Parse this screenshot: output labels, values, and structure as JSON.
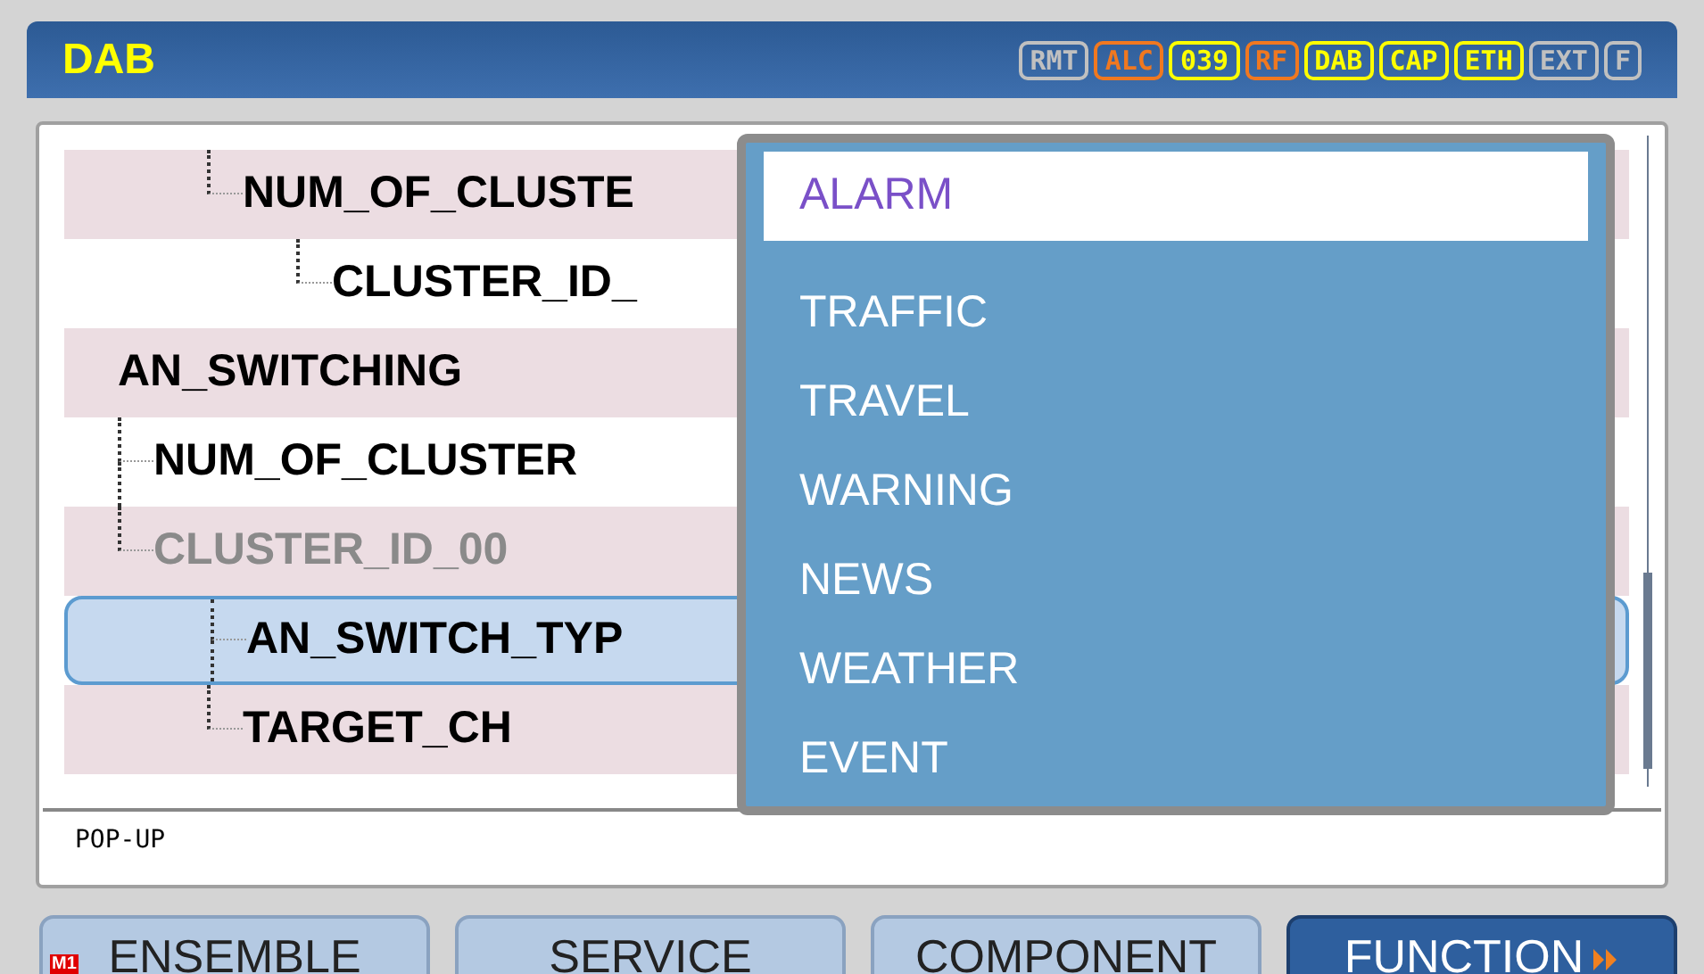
{
  "header": {
    "title": "DAB",
    "badges": [
      {
        "label": "RMT",
        "color": "#c0c0c0"
      },
      {
        "label": "ALC",
        "color": "#f07820"
      },
      {
        "label": "039",
        "color": "#ffff00"
      },
      {
        "label": "RF",
        "color": "#f07820"
      },
      {
        "label": "DAB",
        "color": "#ffff00"
      },
      {
        "label": "CAP",
        "color": "#ffff00"
      },
      {
        "label": "ETH",
        "color": "#ffff00"
      },
      {
        "label": "EXT",
        "color": "#c0c0c0"
      },
      {
        "label": "F",
        "color": "#c0c0c0"
      }
    ]
  },
  "tree": {
    "partial_branch": [
      {
        "label": "NUM_OF_CLUSTE",
        "disabled": false,
        "selected": false,
        "children": [
          {
            "label": "CLUSTER_ID_",
            "disabled": false,
            "selected": false
          }
        ]
      }
    ],
    "items": [
      {
        "label": "AN_SWITCHING",
        "disabled": false,
        "selected": false,
        "children": [
          {
            "label": "NUM_OF_CLUSTER",
            "disabled": false,
            "selected": false
          },
          {
            "label": "CLUSTER_ID_00",
            "disabled": true,
            "selected": false,
            "children": [
              {
                "label": "AN_SWITCH_TYP",
                "disabled": false,
                "selected": true
              },
              {
                "label": "TARGET_CH",
                "disabled": false,
                "selected": false
              }
            ]
          }
        ]
      }
    ]
  },
  "popup": {
    "items": [
      {
        "label": "ALARM",
        "selected": true
      },
      {
        "label": "TRAFFIC",
        "selected": false
      },
      {
        "label": "TRAVEL",
        "selected": false
      },
      {
        "label": "WARNING",
        "selected": false
      },
      {
        "label": "NEWS",
        "selected": false
      },
      {
        "label": "WEATHER",
        "selected": false
      },
      {
        "label": "EVENT",
        "selected": false
      }
    ]
  },
  "status": "POP-UP",
  "tabs": [
    {
      "label": "ENSEMBLE",
      "badge": "M1",
      "selected": false
    },
    {
      "label": "SERVICE",
      "selected": false
    },
    {
      "label": "COMPONENT",
      "selected": false
    },
    {
      "label": "FUNCTION",
      "selected": true
    }
  ]
}
